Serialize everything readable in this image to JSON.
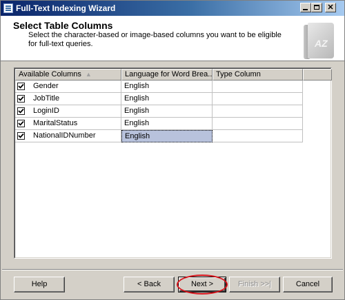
{
  "window": {
    "title": "Full-Text Indexing Wizard"
  },
  "header": {
    "title": "Select Table Columns",
    "description": "Select the character-based or image-based columns you want to be eligible for full-text queries.",
    "icon_text": "AZ"
  },
  "grid": {
    "columns": [
      "Available Columns",
      "Language for Word Brea...",
      "Type Column"
    ],
    "rows": [
      {
        "checked": true,
        "name": "Gender",
        "language": "English",
        "type": ""
      },
      {
        "checked": true,
        "name": "JobTitle",
        "language": "English",
        "type": ""
      },
      {
        "checked": true,
        "name": "LoginID",
        "language": "English",
        "type": ""
      },
      {
        "checked": true,
        "name": "MaritalStatus",
        "language": "English",
        "type": ""
      },
      {
        "checked": true,
        "name": "NationalIDNumber",
        "language": "English",
        "type": "",
        "selected": true
      }
    ]
  },
  "buttons": {
    "help": "Help",
    "back": "< Back",
    "next": "Next >",
    "finish": "Finish >>|",
    "cancel": "Cancel"
  },
  "colors": {
    "titlebar": "#0a246a",
    "selection": "#b8c2dc",
    "highlight_circle": "#d8141c"
  }
}
